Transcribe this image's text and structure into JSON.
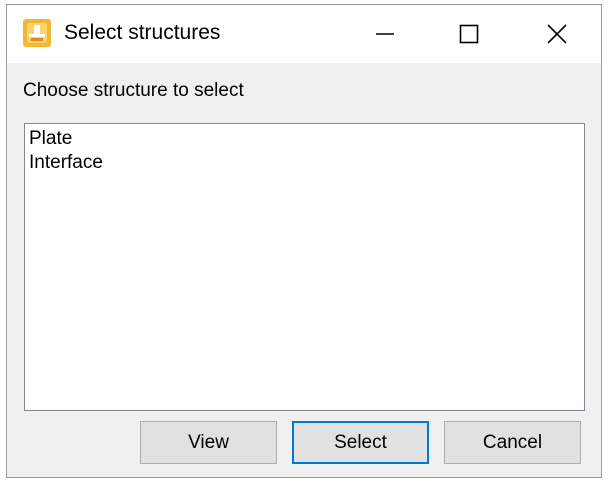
{
  "window": {
    "title": "Select structures",
    "icon": "app-logo-icon",
    "controls": {
      "minimize_icon": "minimize-icon",
      "maximize_icon": "maximize-icon",
      "close_icon": "close-icon"
    }
  },
  "dialog": {
    "prompt": "Choose structure to select",
    "structures": [
      "Plate",
      "Interface"
    ]
  },
  "buttons": {
    "view_label": "View",
    "select_label": "Select",
    "cancel_label": "Cancel"
  },
  "colors": {
    "icon_accent": "#f5b731",
    "default_button_border": "#0078d7"
  }
}
